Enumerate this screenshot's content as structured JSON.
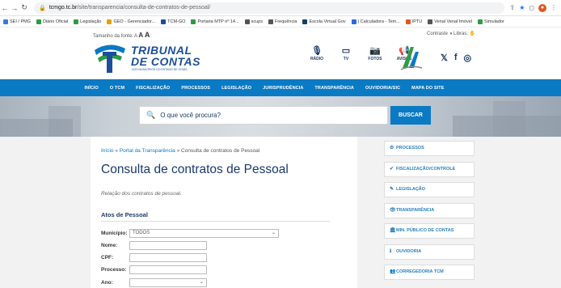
{
  "browser": {
    "url_domain": "tcmgo.tc.br",
    "url_path": "/site/transparencia/consulta-de-contratos-de-pessoal/",
    "bookmarks": [
      {
        "label": "SEI / PMG",
        "color": "#3a7bd5"
      },
      {
        "label": "Diário Oficial",
        "color": "#2e9b46"
      },
      {
        "label": "Legislação",
        "color": "#2e9b46"
      },
      {
        "label": "GEO - Gerenciador...",
        "color": "#e0a100"
      },
      {
        "label": "TCM-GO",
        "color": "#1b4f9c"
      },
      {
        "label": "Portaria MTP nº 14...",
        "color": "#2e9b46"
      },
      {
        "label": "scups",
        "color": "#555555"
      },
      {
        "label": "Frequência",
        "color": "#555555"
      },
      {
        "label": "Escola Virtual Gov",
        "color": "#1b3a6b"
      },
      {
        "label": "| Calculadora - Tem...",
        "color": "#2e6bd8"
      },
      {
        "label": "IPTU",
        "color": "#e25822"
      },
      {
        "label": "Venal Venal Imóvel",
        "color": "#555555"
      },
      {
        "label": "Simulador",
        "color": "#2e9b46"
      }
    ]
  },
  "accessibility": {
    "font_size_label": "Tamanho da fonte:",
    "font_small": "A",
    "font_medium": "A",
    "font_large": "A",
    "contrast_label": "Contraste",
    "libras_label": "Libras:"
  },
  "header": {
    "logo_line1": "TRIBUNAL",
    "logo_line2": "DE CONTAS",
    "logo_line3": "DOS MUNICÍPIOS DO ESTADO DE GOIÁS",
    "icons": [
      {
        "label": "RÁDIO",
        "icon": "microphone-icon",
        "glyph": "🎙"
      },
      {
        "label": "TV",
        "icon": "tv-icon",
        "glyph": "▭"
      },
      {
        "label": "FOTOS",
        "icon": "camera-icon",
        "glyph": "📷"
      },
      {
        "label": "AVISOS",
        "icon": "megaphone-icon",
        "glyph": "📢"
      }
    ],
    "social": [
      "𝕏",
      "f",
      "◎"
    ]
  },
  "menu": [
    "INÍCIO",
    "O TCM",
    "FISCALIZAÇÃO",
    "PROCESSOS",
    "LEGISLAÇÃO",
    "JURISPRUDÊNCIA",
    "TRANSPARÊNCIA",
    "OUVIDORIA/SIC",
    "MAPA DO SITE"
  ],
  "search": {
    "placeholder": "O que você procura?",
    "button": "BUSCAR"
  },
  "page": {
    "breadcrumb_home": "Início",
    "breadcrumb_sep": " » ",
    "breadcrumb_mid": "Portal da Transparência",
    "breadcrumb_current": "Consulta de contratos de Pessoal",
    "title": "Consulta de contratos de Pessoal",
    "subtitle": "Relação dos contratos de pessoal.",
    "section": "Atos de Pessoal"
  },
  "form": {
    "municipio_label": "Município:",
    "municipio_value": "TODOS",
    "nome_label": "Nome:",
    "cpf_label": "CPF:",
    "processo_label": "Processo:",
    "ano_label": "Ano:"
  },
  "sidebar": [
    {
      "label": "PROCESSOS",
      "icon": "gear-icon",
      "glyph": "⚙"
    },
    {
      "label": "FISCALIZAÇÃO/CONTROLE",
      "icon": "check-circle-icon",
      "glyph": "✔"
    },
    {
      "label": "LEGISLAÇÃO",
      "icon": "gavel-icon",
      "glyph": "✎"
    },
    {
      "label": "TRANSPARÊNCIA",
      "icon": "eye-icon",
      "glyph": "👁"
    },
    {
      "label": "MIN. PÚBLICO DE CONTAS",
      "icon": "building-icon",
      "glyph": "🏛"
    },
    {
      "label": "OUVIDORIA",
      "icon": "info-icon",
      "glyph": "ℹ"
    },
    {
      "label": "CORREGEDORIA TCM",
      "icon": "users-icon",
      "glyph": "👥"
    }
  ]
}
